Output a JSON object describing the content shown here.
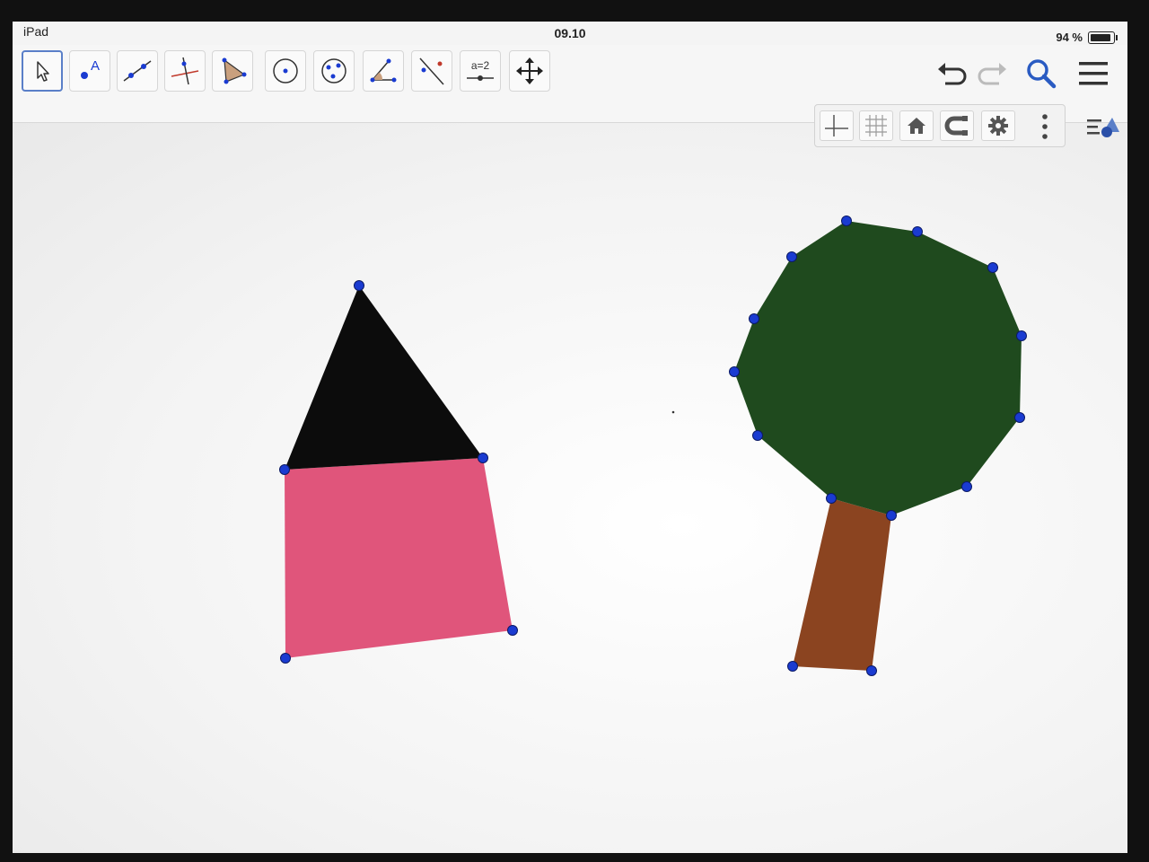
{
  "status_bar": {
    "carrier": "iPad",
    "time": "09.10",
    "battery": "94 %"
  },
  "toolbar": {
    "tools": [
      {
        "name": "move-tool",
        "icon": "pointer-arrow-icon",
        "active": true
      },
      {
        "name": "point-tool",
        "icon": "point-a-icon"
      },
      {
        "name": "line-tool",
        "icon": "line-through-points-icon"
      },
      {
        "name": "perpendicular-line-tool",
        "icon": "perpendicular-line-icon"
      },
      {
        "name": "polygon-tool",
        "icon": "triangle-polygon-icon"
      },
      {
        "name": "circle-center-point-tool",
        "icon": "circle-center-icon"
      },
      {
        "name": "circle-three-points-tool",
        "icon": "circle-three-points-icon"
      },
      {
        "name": "angle-tool",
        "icon": "angle-icon"
      },
      {
        "name": "reflect-tool",
        "icon": "reflect-line-icon"
      },
      {
        "name": "slider-tool",
        "icon": "slider-icon",
        "label": "a=2"
      },
      {
        "name": "move-graphics-view-tool",
        "icon": "move-cross-icon"
      }
    ],
    "right": [
      {
        "name": "undo-button",
        "icon": "undo-icon"
      },
      {
        "name": "redo-button",
        "icon": "redo-icon"
      },
      {
        "name": "search-button",
        "icon": "search-icon"
      },
      {
        "name": "menu-button",
        "icon": "hamburger-menu-icon"
      }
    ]
  },
  "graphics_bar": {
    "buttons": [
      {
        "name": "axes-toggle",
        "icon": "axes-icon"
      },
      {
        "name": "grid-toggle",
        "icon": "grid-icon"
      },
      {
        "name": "standard-view-button",
        "icon": "home-icon"
      },
      {
        "name": "point-capturing-button",
        "icon": "magnet-icon"
      },
      {
        "name": "graphics-settings-button",
        "icon": "gear-icon"
      }
    ],
    "more_icon": "vertical-dots-icon",
    "style_bar_icon": "style-bar-toggle-icon"
  },
  "colors": {
    "accent": "#5a7fc8",
    "point": "#1a3bd1",
    "roof": "#0c0c0c",
    "house_wall": "#e0557b",
    "foliage": "#1f4a1e",
    "trunk": "#8b4420"
  }
}
